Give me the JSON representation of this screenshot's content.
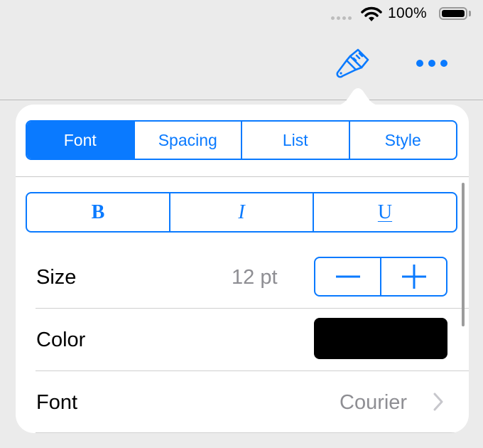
{
  "status_bar": {
    "battery_percent": "100%",
    "battery_level": 1.0,
    "icons": [
      "cellular-signal-icon",
      "wifi-icon",
      "battery-icon"
    ]
  },
  "toolbar": {
    "format_button_icon": "paintbrush-icon",
    "more_button_icon": "ellipsis-icon"
  },
  "colors": {
    "accent": "#0a7aff",
    "secondary_text": "#8e8e93",
    "text_color_swatch": "#000000"
  },
  "popover": {
    "tabs": [
      {
        "label": "Font",
        "active": true
      },
      {
        "label": "Spacing",
        "active": false
      },
      {
        "label": "List",
        "active": false
      },
      {
        "label": "Style",
        "active": false
      }
    ],
    "text_style_buttons": [
      {
        "label": "B",
        "name": "bold"
      },
      {
        "label": "I",
        "name": "italic"
      },
      {
        "label": "U",
        "name": "underline"
      }
    ],
    "size_row": {
      "label": "Size",
      "value": "12 pt",
      "decrement_icon": "minus-icon",
      "increment_icon": "plus-icon"
    },
    "color_row": {
      "label": "Color",
      "value": "#000000"
    },
    "font_row": {
      "label": "Font",
      "value": "Courier"
    }
  }
}
